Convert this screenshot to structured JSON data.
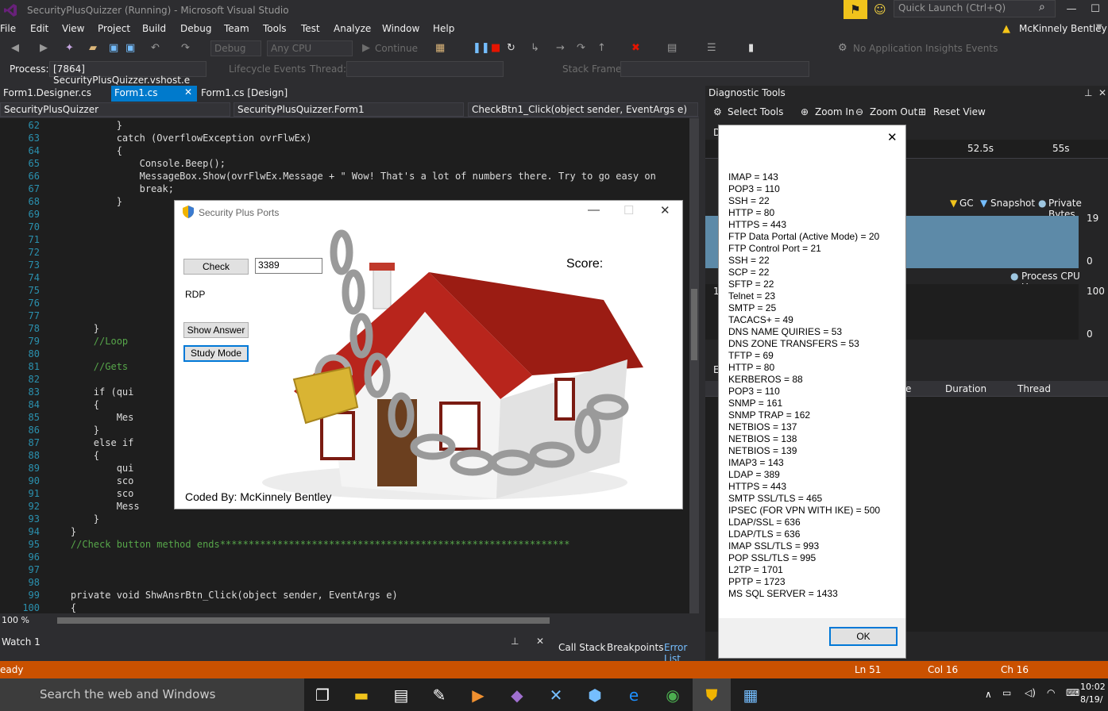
{
  "window": {
    "title": "SecurityPlusQuizzer (Running) - Microsoft Visual Studio"
  },
  "quick_launch": {
    "placeholder": "Quick Launch (Ctrl+Q)"
  },
  "menu": [
    "File",
    "Edit",
    "View",
    "Project",
    "Build",
    "Debug",
    "Team",
    "Tools",
    "Test",
    "Analyze",
    "Window",
    "Help"
  ],
  "account": "McKinnely Bentley",
  "toolbar": {
    "config": "Debug",
    "platform": "Any CPU",
    "continue": "Continue",
    "insights": "No Application Insights Events"
  },
  "toolbar2": {
    "process_label": "Process:",
    "process_value": "[7864] SecurityPlusQuizzer.vshost.e",
    "lifecycle": "Lifecycle Events",
    "thread_label": "Thread:",
    "stack_label": "Stack Frame:"
  },
  "editor_tabs": [
    "Form1.Designer.cs",
    "Form1.cs",
    "Form1.cs [Design]"
  ],
  "navbar": {
    "project": "SecurityPlusQuizzer",
    "class": "SecurityPlusQuizzer.Form1",
    "method": "CheckBtn1_Click(object sender, EventArgs e)"
  },
  "code_lines": [
    {
      "n": "62",
      "t": "            }"
    },
    {
      "n": "63",
      "t": "            catch (OverflowException ovrFlwEx)"
    },
    {
      "n": "64",
      "t": "            {"
    },
    {
      "n": "65",
      "t": "                Console.Beep();"
    },
    {
      "n": "66",
      "t": "                MessageBox.Show(ovrFlwEx.Message + \" Wow! That's a lot of numbers there. Try to go easy on"
    },
    {
      "n": "67",
      "t": "                break;"
    },
    {
      "n": "68",
      "t": "            }"
    },
    {
      "n": "69",
      "t": ""
    },
    {
      "n": "70",
      "t": ""
    },
    {
      "n": "71",
      "t": ""
    },
    {
      "n": "72",
      "t": ""
    },
    {
      "n": "73",
      "t": ""
    },
    {
      "n": "74",
      "t": ""
    },
    {
      "n": "75",
      "t": ""
    },
    {
      "n": "76",
      "t": ""
    },
    {
      "n": "77",
      "t": ""
    },
    {
      "n": "78",
      "t": "        }"
    },
    {
      "n": "79",
      "t": "        //Loop"
    },
    {
      "n": "80",
      "t": ""
    },
    {
      "n": "81",
      "t": "        //Gets"
    },
    {
      "n": "82",
      "t": ""
    },
    {
      "n": "83",
      "t": "        if (qui"
    },
    {
      "n": "84",
      "t": "        {"
    },
    {
      "n": "85",
      "t": "            Mes"
    },
    {
      "n": "86",
      "t": "        }"
    },
    {
      "n": "87",
      "t": "        else if"
    },
    {
      "n": "88",
      "t": "        {"
    },
    {
      "n": "89",
      "t": "            qui"
    },
    {
      "n": "90",
      "t": "            sco"
    },
    {
      "n": "91",
      "t": "            sco"
    },
    {
      "n": "92",
      "t": "            Mess"
    },
    {
      "n": "93",
      "t": "        }"
    },
    {
      "n": "94",
      "t": "    }"
    },
    {
      "n": "95",
      "t": "    //Check button method ends*************************************************************"
    },
    {
      "n": "96",
      "t": ""
    },
    {
      "n": "97",
      "t": ""
    },
    {
      "n": "98",
      "t": ""
    },
    {
      "n": "99",
      "t": "    private void ShwAnsrBtn_Click(object sender, EventArgs e)"
    },
    {
      "n": "100",
      "t": "    {"
    }
  ],
  "zoom": "100 %",
  "diagnostic": {
    "title": "Diagnostic Tools",
    "select_tools": "Select Tools",
    "zoom_in": "Zoom In",
    "zoom_out": "Zoom Out",
    "reset_view": "Reset View",
    "time1": "52.5s",
    "time2": "55s",
    "gc": "GC",
    "snapshot": "Snapshot",
    "private_bytes": "Private Bytes",
    "mem_max": "19",
    "mem_min": "0",
    "cpu": "Process CPU Usage",
    "cpu_max": "100",
    "cpu_min": "0",
    "cols": [
      "Duration",
      "Thread"
    ],
    "col_partial": "e",
    "d_partial": "D",
    "e_partial": "E",
    "one_partial": "1"
  },
  "form1": {
    "title": "Security Plus Ports",
    "check_button": "Check",
    "input_value": "3389",
    "result": "RDP",
    "score_label": "Score:",
    "show_answer": "Show Answer",
    "study_mode": "Study Mode",
    "credit": "Coded By: McKinnely Bentley"
  },
  "msgbox": {
    "lines": [
      "IMAP = 143",
      "POP3 = 110",
      "SSH = 22",
      "HTTP = 80",
      "HTTPS = 443",
      "FTP Data Portal (Active Mode) = 20",
      "FTP Control Port = 21",
      "SSH = 22",
      "SCP = 22",
      "SFTP = 22",
      "Telnet = 23",
      "SMTP = 25",
      "TACACS+ = 49",
      "DNS NAME QUIRIES = 53",
      "DNS ZONE TRANSFERS = 53",
      "TFTP = 69",
      "HTTP = 80",
      "KERBEROS = 88",
      "POP3 = 110",
      "SNMP = 161",
      "SNMP TRAP = 162",
      "NETBIOS = 137",
      "NETBIOS = 138",
      "NETBIOS = 139",
      "IMAP3 = 143",
      "LDAP = 389",
      "HTTPS = 443",
      "SMTP SSL/TLS = 465",
      "IPSEC (FOR VPN WITH IKE) = 500",
      "LDAP/SSL = 636",
      "LDAP/TLS = 636",
      "IMAP SSL/TLS = 993",
      "POP SSL/TLS = 995",
      "L2TP = 1701",
      "PPTP = 1723",
      "MS SQL SERVER = 1433"
    ],
    "ok": "OK"
  },
  "watch": {
    "title": "Watch 1",
    "tabs": [
      "Call Stack",
      "Breakpoints",
      "Error List"
    ]
  },
  "status": {
    "left": "eady",
    "ln": "Ln 51",
    "col": "Col 16",
    "ch": "Ch 16"
  },
  "taskbar": {
    "search": "Search the web and Windows",
    "time": "10:02",
    "date": "8/19/"
  }
}
